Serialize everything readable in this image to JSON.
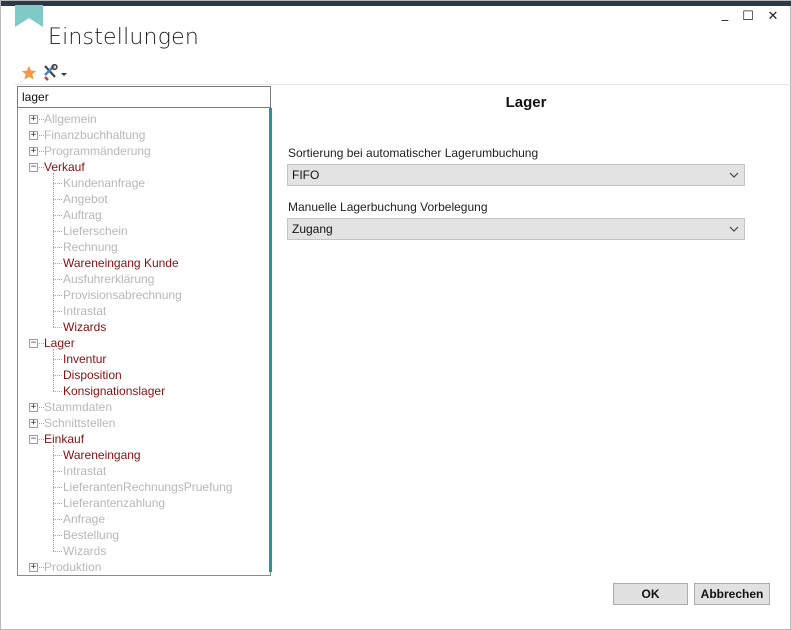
{
  "window": {
    "title": "Einstellungen",
    "controls": {
      "minimize": "_",
      "maximize": "☐",
      "close": "✕"
    }
  },
  "toolbar": {
    "favorite_icon": "star-icon",
    "tools_icon": "tools-icon"
  },
  "search": {
    "value": "lager"
  },
  "tree": {
    "items": [
      {
        "label": "Allgemein",
        "level": 0,
        "state": "collapsed",
        "match": false
      },
      {
        "label": "Finanzbuchhaltung",
        "level": 0,
        "state": "collapsed",
        "match": false
      },
      {
        "label": "Programmänderung",
        "level": 0,
        "state": "collapsed",
        "match": false
      },
      {
        "label": "Verkauf",
        "level": 0,
        "state": "expanded",
        "match": true
      },
      {
        "label": "Kundenanfrage",
        "level": 1,
        "match": false
      },
      {
        "label": "Angebot",
        "level": 1,
        "match": false
      },
      {
        "label": "Auftrag",
        "level": 1,
        "match": false
      },
      {
        "label": "Lieferschein",
        "level": 1,
        "match": false
      },
      {
        "label": "Rechnung",
        "level": 1,
        "match": false
      },
      {
        "label": "Wareneingang Kunde",
        "level": 1,
        "match": true
      },
      {
        "label": "Ausfuhrerklärung",
        "level": 1,
        "match": false
      },
      {
        "label": "Provisionsabrechnung",
        "level": 1,
        "match": false
      },
      {
        "label": "Intrastat",
        "level": 1,
        "match": false
      },
      {
        "label": "Wizards",
        "level": 1,
        "match": true
      },
      {
        "label": "Lager",
        "level": 0,
        "state": "expanded",
        "match": true
      },
      {
        "label": "Inventur",
        "level": 1,
        "match": true
      },
      {
        "label": "Disposition",
        "level": 1,
        "match": true
      },
      {
        "label": "Konsignationslager",
        "level": 1,
        "match": true
      },
      {
        "label": "Stammdaten",
        "level": 0,
        "state": "collapsed",
        "match": false
      },
      {
        "label": "Schnittstellen",
        "level": 0,
        "state": "collapsed",
        "match": false
      },
      {
        "label": "Einkauf",
        "level": 0,
        "state": "expanded",
        "match": true
      },
      {
        "label": "Wareneingang",
        "level": 1,
        "match": true
      },
      {
        "label": "Intrastat",
        "level": 1,
        "match": false
      },
      {
        "label": "LieferantenRechnungsPruefung",
        "level": 1,
        "match": false
      },
      {
        "label": "Lieferantenzahlung",
        "level": 1,
        "match": false
      },
      {
        "label": "Anfrage",
        "level": 1,
        "match": false
      },
      {
        "label": "Bestellung",
        "level": 1,
        "match": false
      },
      {
        "label": "Wizards",
        "level": 1,
        "match": false
      },
      {
        "label": "Produktion",
        "level": 0,
        "state": "collapsed",
        "match": false
      }
    ]
  },
  "panel": {
    "title": "Lager",
    "fields": [
      {
        "label": "Sortierung bei automatischer Lagerumbuchung",
        "value": "FIFO"
      },
      {
        "label": "Manuelle Lagerbuchung Vorbelegung",
        "value": "Zugang"
      }
    ]
  },
  "buttons": {
    "ok": "OK",
    "cancel": "Abbrechen"
  },
  "colors": {
    "accent": "#1b9aa0",
    "match": "#8b0f0f",
    "dim": "#b8b8b8",
    "bookmark": "#7fcac6"
  }
}
